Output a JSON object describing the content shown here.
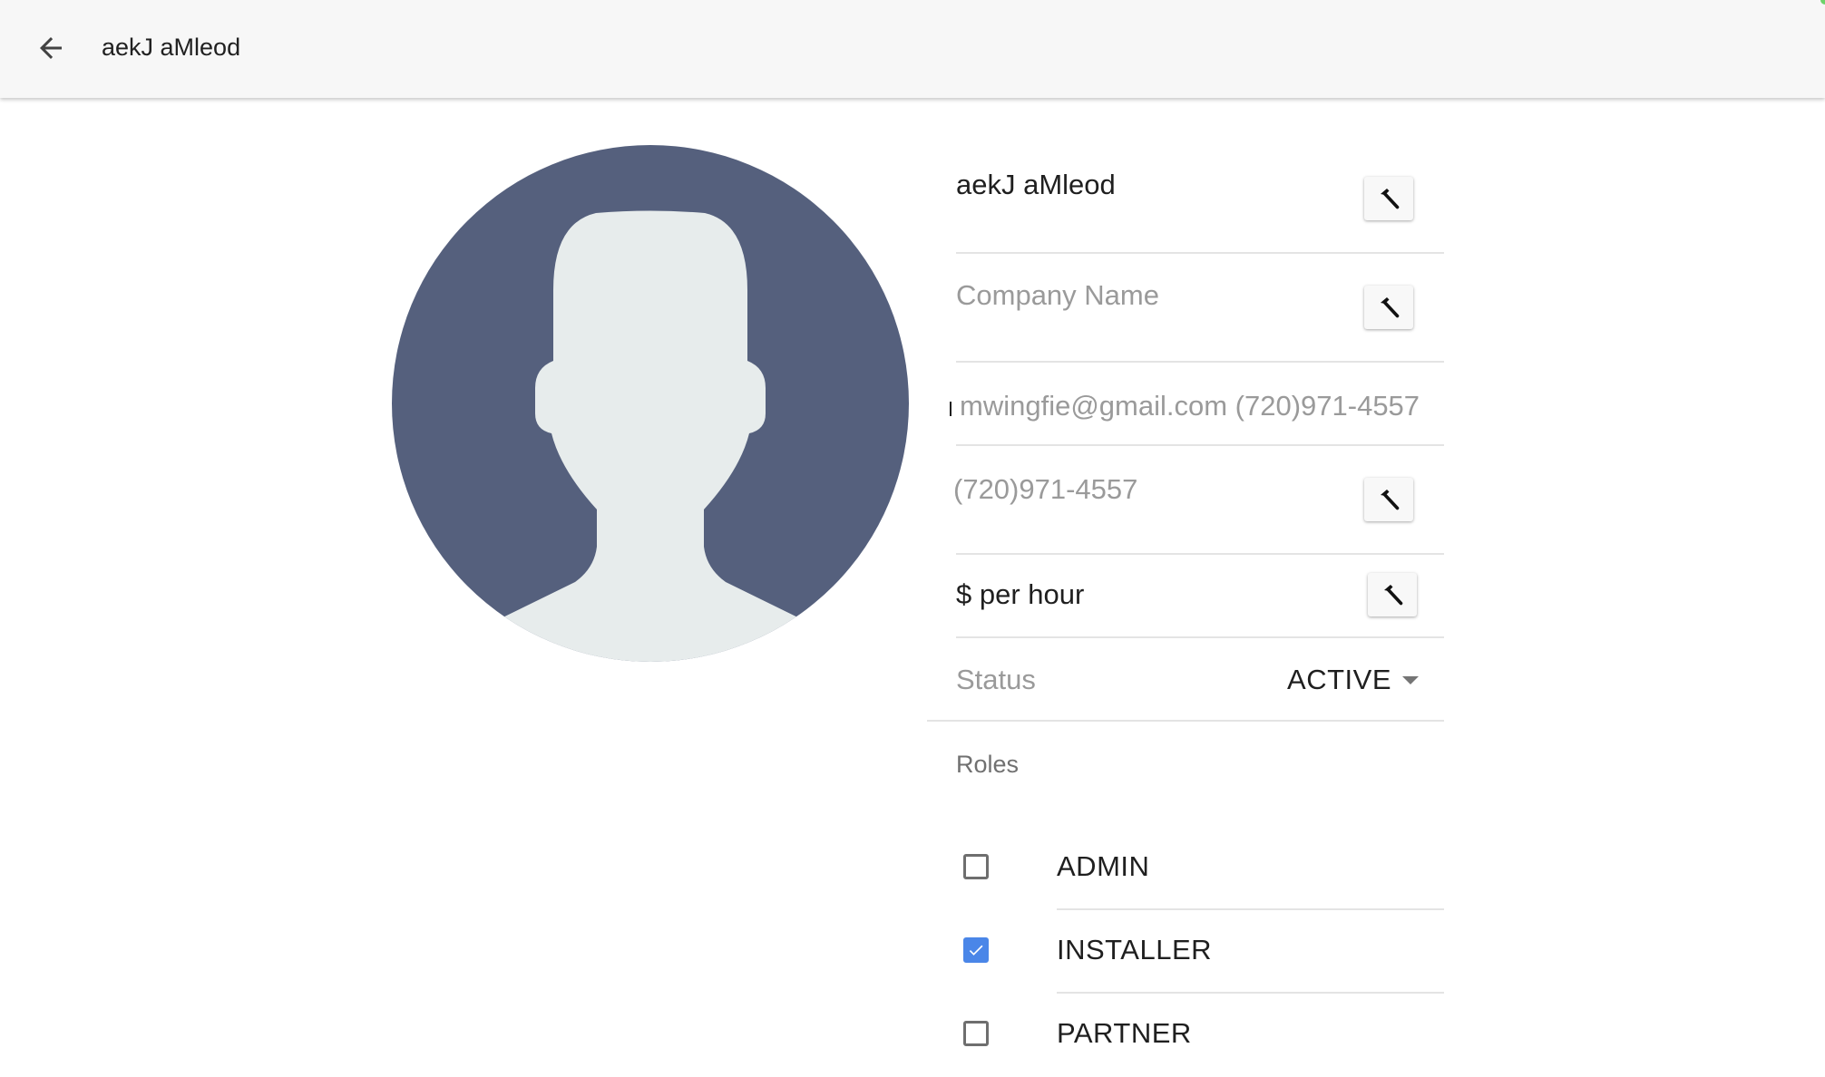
{
  "app_bar": {
    "title": "aekJ aMleod",
    "back_icon": "arrow-back-icon"
  },
  "avatar": {
    "icon": "default-user-avatar",
    "background": "#55607d",
    "silhouette": "#e7ecec"
  },
  "form": {
    "name": {
      "value": "aekJ aMleod",
      "edit_icon": "hammer-icon"
    },
    "company": {
      "placeholder": "Company Name",
      "edit_icon": "hammer-icon"
    },
    "contact": {
      "value": "mwingfie@gmail.com (720)971-4557"
    },
    "phone": {
      "value": "(720)971-4557",
      "edit_icon": "hammer-icon"
    },
    "rate": {
      "value": "$ per hour",
      "edit_icon": "hammer-icon"
    },
    "status": {
      "label": "Status",
      "value": "ACTIVE"
    }
  },
  "roles": {
    "heading": "Roles",
    "items": [
      {
        "label": "ADMIN",
        "checked": false
      },
      {
        "label": "INSTALLER",
        "checked": true
      },
      {
        "label": "PARTNER",
        "checked": false
      }
    ]
  },
  "colors": {
    "accent": "#4a86e8",
    "app_bar_bg": "#f7f7f7",
    "divider": "#e4e4e4"
  }
}
